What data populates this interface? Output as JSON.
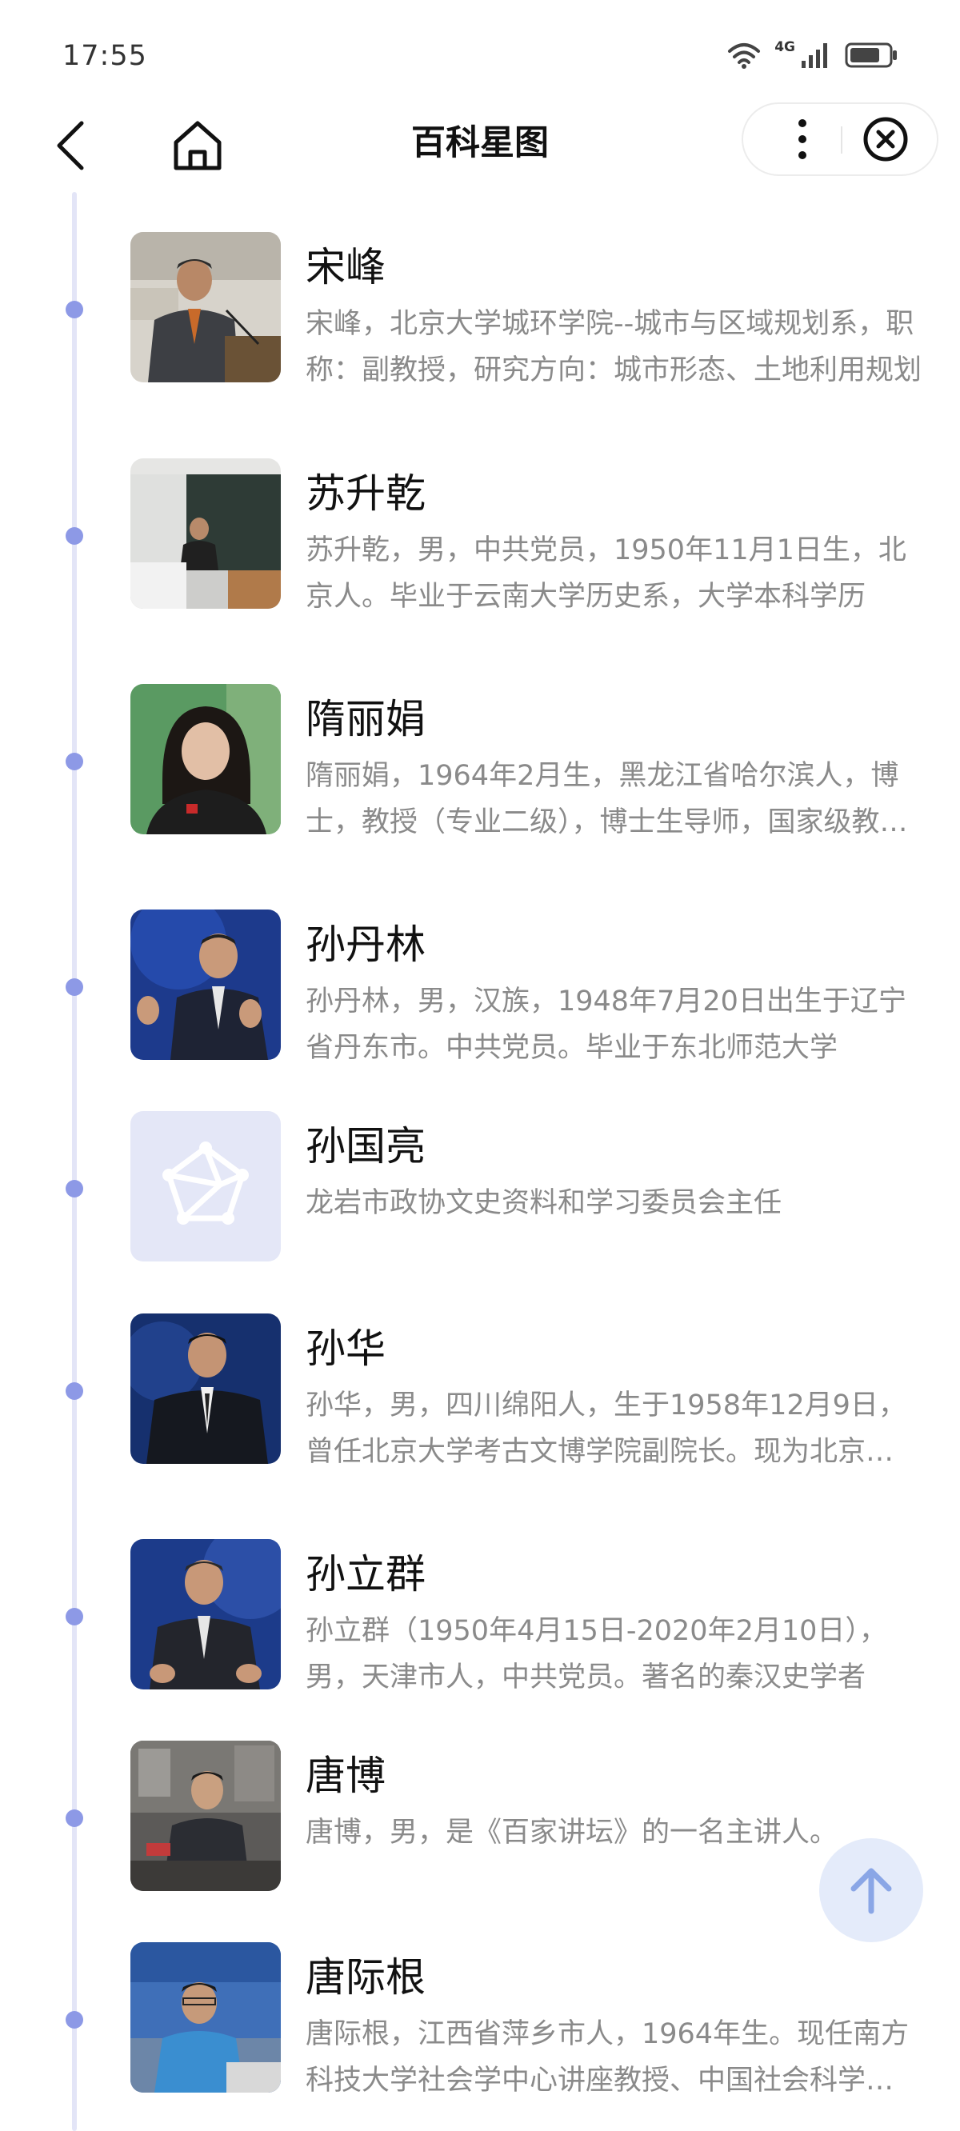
{
  "status_bar": {
    "time": "17:55",
    "network": "4G",
    "icons": [
      "wifi-icon",
      "signal-icon",
      "battery-icon"
    ]
  },
  "nav": {
    "title": "百科星图",
    "back_icon": "chevron-left-icon",
    "home_icon": "home-icon",
    "more_icon": "more-vertical-icon",
    "close_icon": "close-circle-icon"
  },
  "list": {
    "items": [
      {
        "name": "宋峰",
        "desc": "宋峰，北京大学城环学院--城市与区域规划系，职称：副教授，研究方向：城市形态、土地利用规划"
      },
      {
        "name": "苏升乾",
        "desc": "苏升乾，男，中共党员，1950年11月1日生，北京人。毕业于云南大学历史系，大学本科学历"
      },
      {
        "name": "隋丽娟",
        "desc": "隋丽娟，1964年2月生，黑龙江省哈尔滨人，博士，教授（专业二级），博士生导师，国家级教学名师"
      },
      {
        "name": "孙丹林",
        "desc": "孙丹林，男，汉族，1948年7月20日出生于辽宁省丹东市。中共党员。毕业于东北师范大学"
      },
      {
        "name": "孙国亮",
        "desc": "龙岩市政协文史资料和学习委员会主任"
      },
      {
        "name": "孙华",
        "desc": "孙华，男，四川绵阳人，生于1958年12月9日，曾任北京大学考古文博学院副院长。现为北京大学教授"
      },
      {
        "name": "孙立群",
        "desc": "孙立群（1950年4月15日-2020年2月10日），男，天津市人，中共党员。著名的秦汉史学者"
      },
      {
        "name": "唐博",
        "desc": "唐博，男，是《百家讲坛》的一名主讲人。"
      },
      {
        "name": "唐际根",
        "desc": "唐际根，江西省萍乡市人，1964年生。现任南方科技大学社会学中心讲座教授、中国社会科学院考古研究所研究员"
      }
    ]
  },
  "placeholder_icon": "network-star-icon",
  "to_top_icon": "arrow-up-icon",
  "colors": {
    "timeline": "#e3e5f7",
    "dot": "#8d99e6",
    "placeholder_bg": "#e4e7f7",
    "to_top_bg": "#e2e9fa",
    "to_top_arrow": "#8aa6e6"
  }
}
